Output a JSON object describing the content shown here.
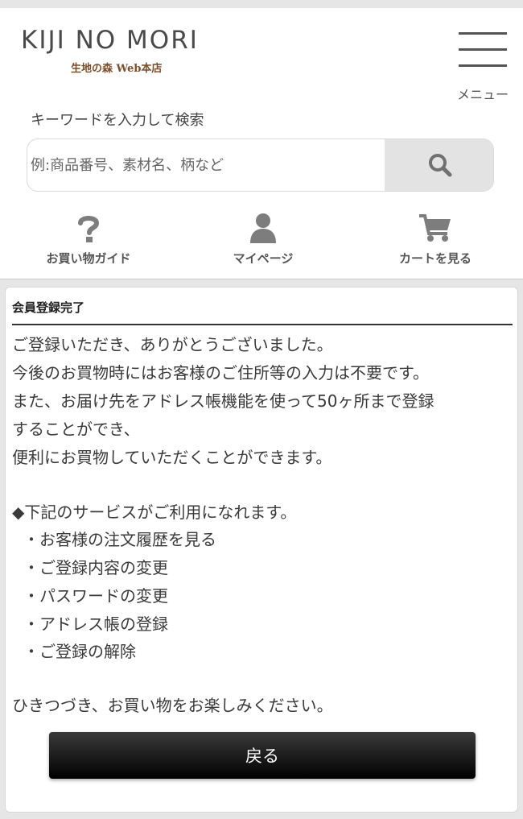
{
  "header": {
    "logo_main": "KIJI NO MORI",
    "logo_sub": "生地の森 Web本店",
    "menu_label": "メニュー"
  },
  "search": {
    "label": "キーワードを入力して検索",
    "placeholder": "例:商品番号、素材名、柄など"
  },
  "quick_links": [
    {
      "label": "お買い物ガイド",
      "icon": "question-icon"
    },
    {
      "label": "マイページ",
      "icon": "user-icon"
    },
    {
      "label": "カートを見る",
      "icon": "cart-icon"
    }
  ],
  "content": {
    "title": "会員登録完了",
    "lines": [
      "ご登録いただき、ありがとうございました。",
      "今後のお買物時にはお客様のご住所等の入力は不要です。",
      "また、お届け先をアドレス帳機能を使って50ヶ所まで登録",
      "することができ、",
      "便利にお買物していただくことができます。"
    ],
    "services_heading": "◆下記のサービスがご利用になれます。",
    "services": [
      "・お客様の注文履歴を見る",
      "・ご登録内容の変更",
      "・パスワードの変更",
      "・アドレス帳の登録",
      "・ご登録の解除"
    ],
    "closing": "ひきつづき、お買い物をお楽しみください。",
    "back_label": "戻る"
  },
  "colors": {
    "background": "#e6e6e6",
    "logo_sub": "#7a4f2a",
    "icon_gray": "#7d7d7d",
    "button_dark": "#000000"
  }
}
